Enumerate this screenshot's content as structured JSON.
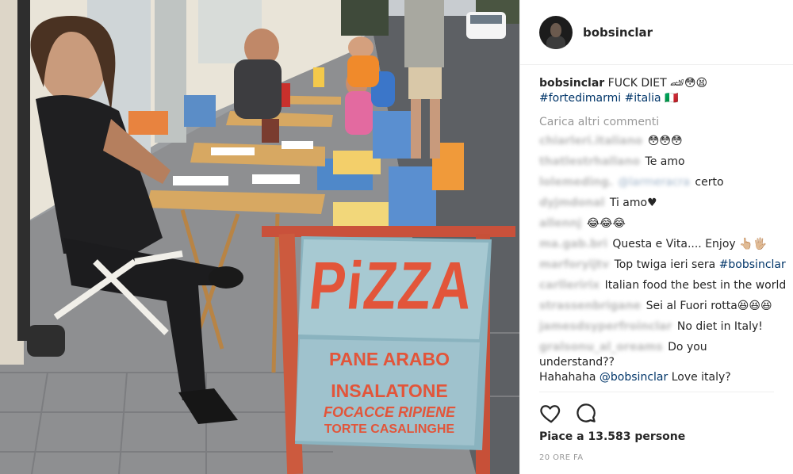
{
  "post": {
    "username": "bobsinclar",
    "caption": {
      "user": "bobsinclar",
      "text": "FUCK DIET 🏎😳😫",
      "hashtags": "#fortedimarmi #italia 🇮🇹"
    },
    "load_more": "Carica altri commenti",
    "comments": [
      {
        "user": "chiarleri.italiano",
        "text": "😳😳😳"
      },
      {
        "user": "thatlestrhallano",
        "text": "Te amo"
      },
      {
        "user": "lolemeding.",
        "mention": "@larmeracra",
        "text": " certo"
      },
      {
        "user": "dyjmdonal",
        "text": "Ti amo♥"
      },
      {
        "user": "allennj",
        "text": "😂😂😂"
      },
      {
        "user": "ma.gab.bri",
        "text": "Questa e Vita.... Enjoy 👆🏼🖐🏼"
      },
      {
        "user": "marforyijtv",
        "text": "Top twiga ieri sera ",
        "hashtag": "#bobsinclar"
      },
      {
        "user": "carlleririx",
        "text": "Italian food the best in the world"
      },
      {
        "user": "strassenbrigane",
        "text": "Sei al Fuori rotta😆😆😆"
      },
      {
        "user": "jamesdsyperfroinclar",
        "text": "No diet in Italy!"
      },
      {
        "user": "gralsonu_al_oreams",
        "text": "Do you understand??",
        "continued_prefix": "Hahahaha ",
        "continued_mention": "@bobsinclar",
        "continued_text": " Love italy?"
      }
    ],
    "likes": "Piace a 13.583 persone",
    "time": "20 ORE FA"
  },
  "photo": {
    "sign_heading": "PiZZA",
    "sign_lines": [
      "PANE ARABO",
      "INSALATONE",
      "FOCACCE RIPIENE",
      "TORTE CASALINGHE"
    ]
  }
}
